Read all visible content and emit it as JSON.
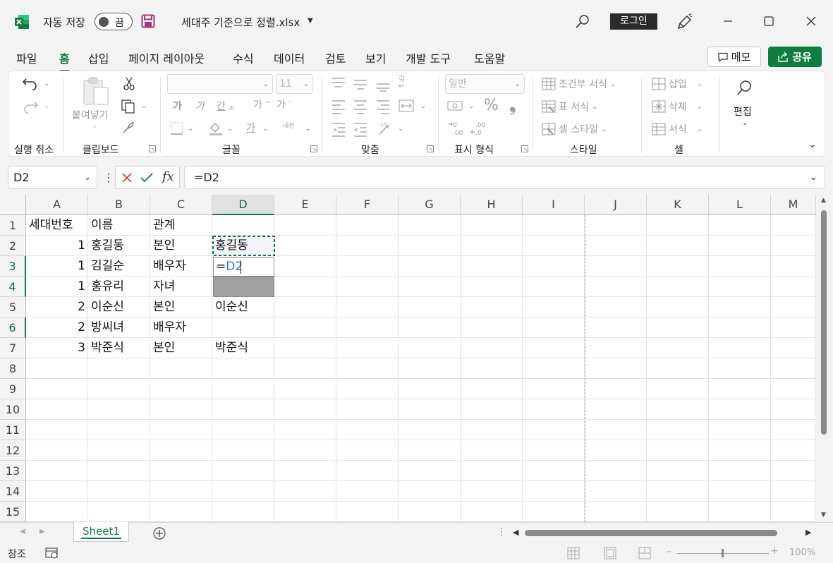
{
  "titlebar": {
    "autosave_label": "자동 저장",
    "autosave_state": "끔",
    "filename": "세대주 기준으로 정렬.xlsx",
    "login_label": "로그인",
    "icons": [
      "excel-logo-icon",
      "save-icon",
      "search-icon",
      "pen-icon",
      "minimize-icon",
      "maximize-icon",
      "close-icon"
    ]
  },
  "menu": {
    "tabs": [
      "파일",
      "홈",
      "삽입",
      "페이지 레이아웃",
      "수식",
      "데이터",
      "검토",
      "보기",
      "개발 도구",
      "도움말"
    ],
    "active": "홈",
    "memo_label": "메모",
    "share_label": "공유"
  },
  "ribbon": {
    "undo_group_label": "실행 취소",
    "clipboard_group_label": "클립보드",
    "paste_label": "붙여넣기",
    "font_group_label": "글꼴",
    "font_size": "11",
    "font_inc_label": "가",
    "font_dec_label": "가",
    "bold_label": "가",
    "italic_label": "가",
    "underline_label": "간",
    "font_color_label": "가",
    "phonetic_label": "내천",
    "align_group_label": "맞춤",
    "wrap_label": "갂",
    "number_group_label": "표시 형식",
    "number_format": "일반",
    "percent_label": "%",
    "comma_label": "❟",
    "style_group_label": "스타일",
    "conditional_format_label": "조건부 서식",
    "format_table_label": "표 서식",
    "cell_style_label": "셀 스타일",
    "cells_group_label": "셀",
    "insert_label": "삽입",
    "delete_label": "삭제",
    "format_label": "서식",
    "edit_label": "편집"
  },
  "formula_bar": {
    "name_box": "D2",
    "formula": "=D2",
    "fx_label": "fx"
  },
  "grid": {
    "columns": [
      "A",
      "B",
      "C",
      "D",
      "E",
      "F",
      "G",
      "H",
      "I",
      "J",
      "K",
      "L",
      "M"
    ],
    "selected_column": "D",
    "rows": [
      "1",
      "2",
      "3",
      "4",
      "5",
      "6",
      "7",
      "8",
      "9",
      "10",
      "11",
      "12",
      "13",
      "14",
      "15"
    ],
    "cells": {
      "A1": "세대번호",
      "B1": "이름",
      "C1": "관계",
      "A2": "1",
      "B2": "홍길동",
      "C2": "본인",
      "D2": "홍길동",
      "A3": "1",
      "B3": "김길순",
      "C3": "배우자",
      "D3": "=D2",
      "A4": "1",
      "B4": "홍유리",
      "C4": "자녀",
      "A5": "2",
      "B5": "이순신",
      "C5": "본인",
      "D5": "이순신",
      "A6": "2",
      "B6": "방씨녀",
      "C6": "배우자",
      "A7": "3",
      "B7": "박준식",
      "C7": "본인",
      "D7": "박준식"
    }
  },
  "sheets": {
    "tabs": [
      "Sheet1"
    ],
    "active": "Sheet1"
  },
  "status": {
    "mode": "참조",
    "zoom": "100%"
  },
  "colors": {
    "accent": "#107c41",
    "selection_border": "#1f6b3f",
    "formula_ref": "#3a6fd8",
    "gray_fill": "#a0a0a0"
  }
}
